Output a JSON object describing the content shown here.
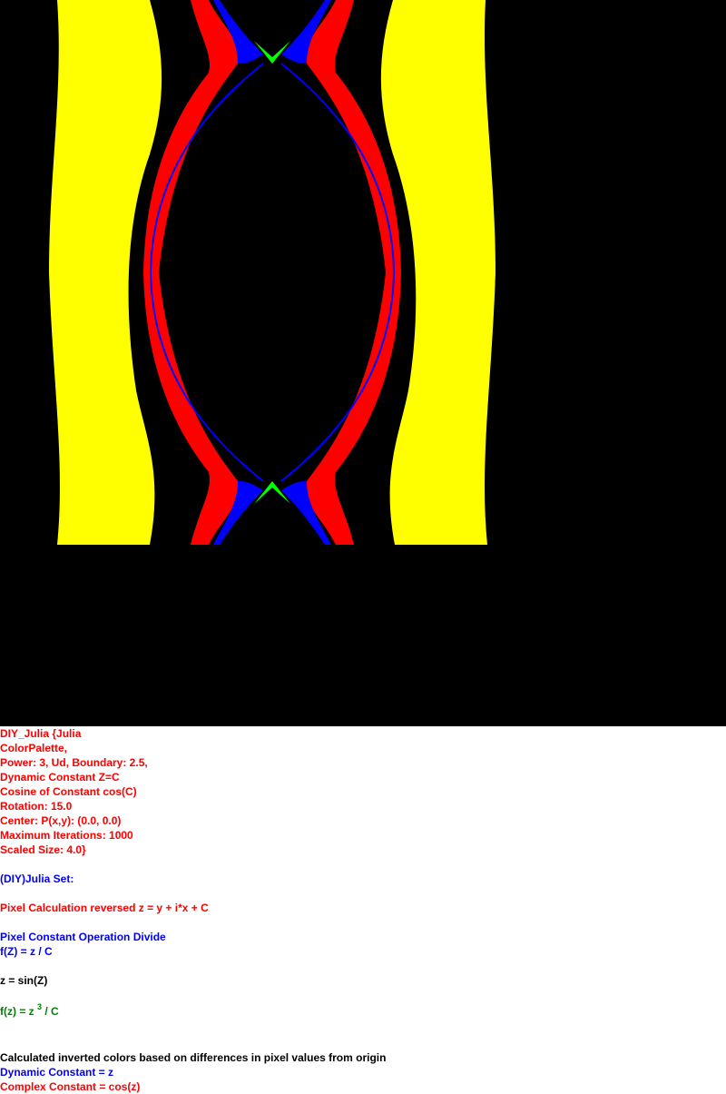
{
  "render": {
    "colors": {
      "background": "#000000",
      "band_outer": "#ffff00",
      "band_inner": "#ff0000",
      "band_edge": "#0000ff",
      "band_tip": "#00ff00"
    }
  },
  "info": {
    "header_lines": [
      "DIY_Julia {Julia",
      "ColorPalette,",
      "Power: 3, Ud, Boundary: 2.5,",
      "Dynamic Constant Z=C",
      "Cosine of Constant cos(C)",
      "Rotation: 15.0",
      "Center: P(x,y): (0.0, 0.0)",
      "Maximum Iterations: 1000",
      "Scaled Size: 4.0}"
    ],
    "set_title": "(DIY)Julia Set:",
    "pixel_calc": "Pixel Calculation reversed z = y + i*x + C",
    "pixel_op": "Pixel Constant Operation Divide",
    "f_Z": "f(Z) = z / C",
    "z_eq": "z = sin(Z)",
    "fz_prefix": "f(z) = z ",
    "fz_power": "3",
    "fz_suffix": " / C",
    "calc_colors": "Calculated inverted colors based on differences in pixel values from origin",
    "dynamic_const": "Dynamic Constant = z",
    "complex_const": "Complex Constant = cos(z)"
  }
}
